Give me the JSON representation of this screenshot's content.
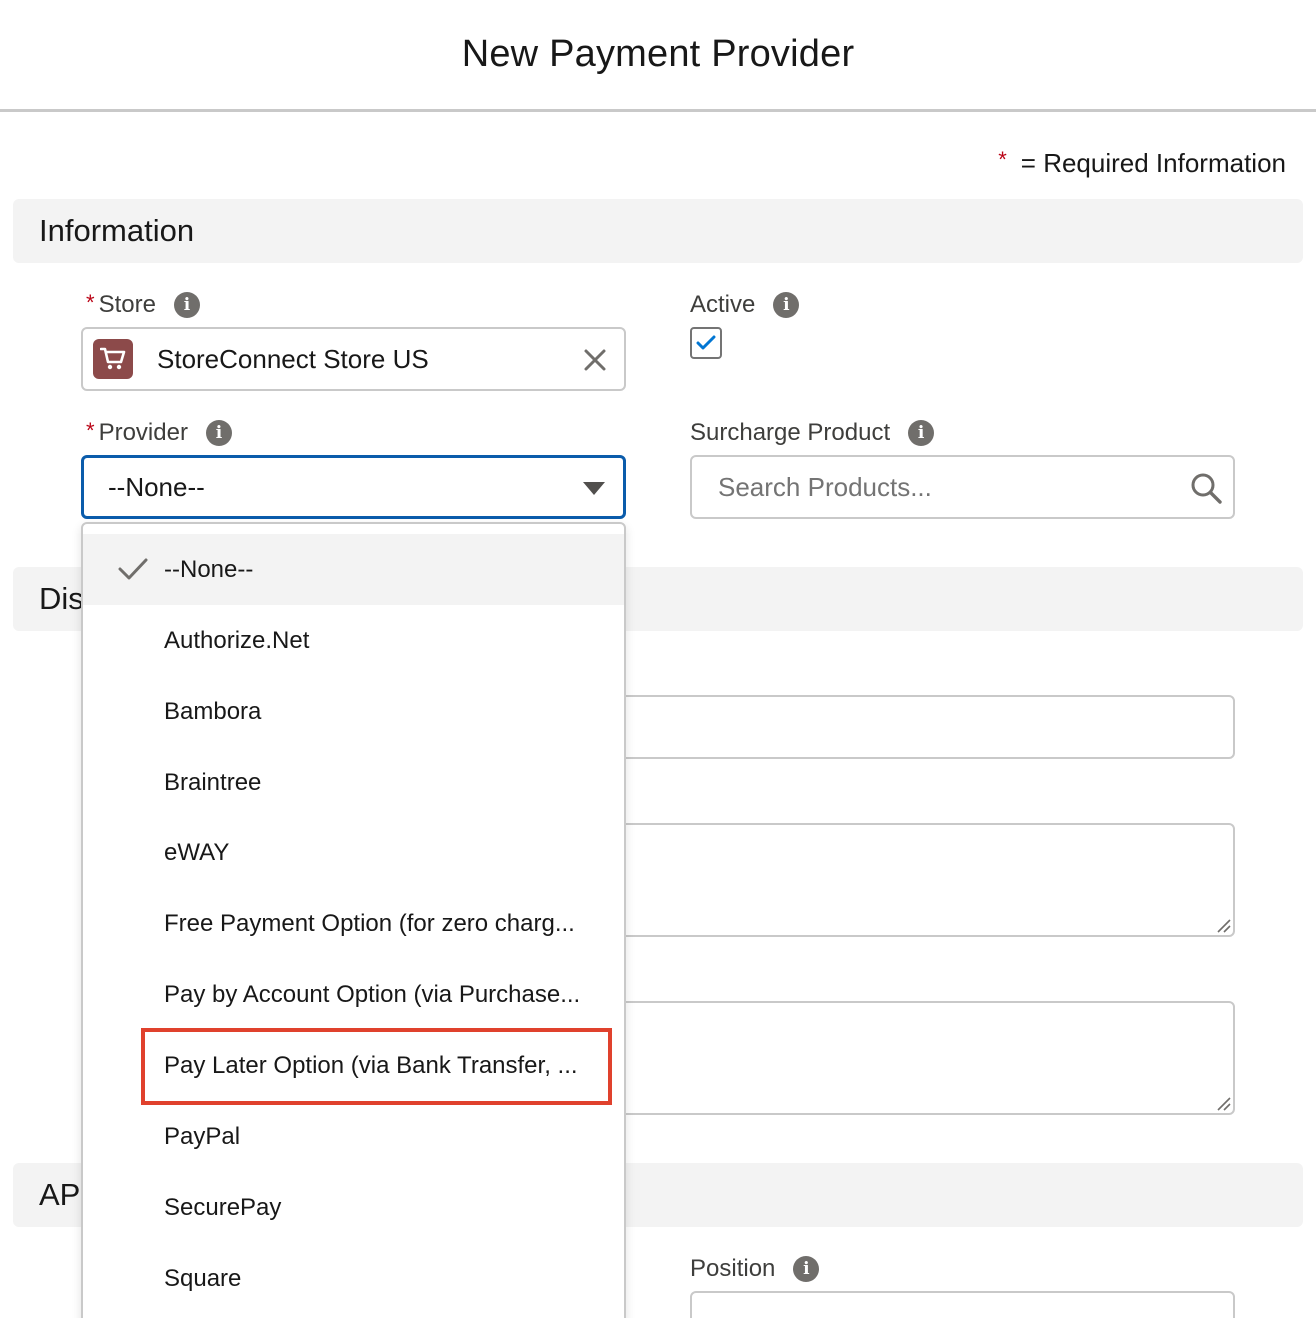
{
  "modal": {
    "title": "New Payment Provider"
  },
  "required_note": {
    "star": "*",
    "text": "= Required Information"
  },
  "sections": {
    "information": "Information",
    "display_partial": "Dis",
    "api_partial": "AP"
  },
  "fields": {
    "store": {
      "required": "*",
      "label": "Store",
      "value": "StoreConnect Store US"
    },
    "active": {
      "label": "Active",
      "checked": true
    },
    "provider": {
      "required": "*",
      "label": "Provider",
      "value": "--None--"
    },
    "surcharge_product": {
      "label": "Surcharge Product",
      "placeholder": "Search Products..."
    },
    "position": {
      "label": "Position"
    }
  },
  "provider_options": [
    {
      "label": "--None--",
      "selected": true
    },
    {
      "label": "Authorize.Net"
    },
    {
      "label": "Bambora"
    },
    {
      "label": "Braintree"
    },
    {
      "label": "eWAY"
    },
    {
      "label": "Free Payment Option (for zero charg..."
    },
    {
      "label": "Pay by Account Option (via Purchase..."
    },
    {
      "label": "Pay Later Option (via Bank Transfer, ...",
      "highlighted": true
    },
    {
      "label": "PayPal"
    },
    {
      "label": "SecurePay"
    },
    {
      "label": "Square"
    }
  ],
  "colors": {
    "required": "#ba0517",
    "focus_border": "#0b5cab",
    "highlight": "#e0412d",
    "store_icon_bg": "#8c4a4a",
    "checkbox_check": "#0176d3"
  },
  "icons": {
    "info": "info-icon",
    "clear": "close-icon",
    "search": "search-icon",
    "store": "cart-icon",
    "check": "check-icon"
  }
}
